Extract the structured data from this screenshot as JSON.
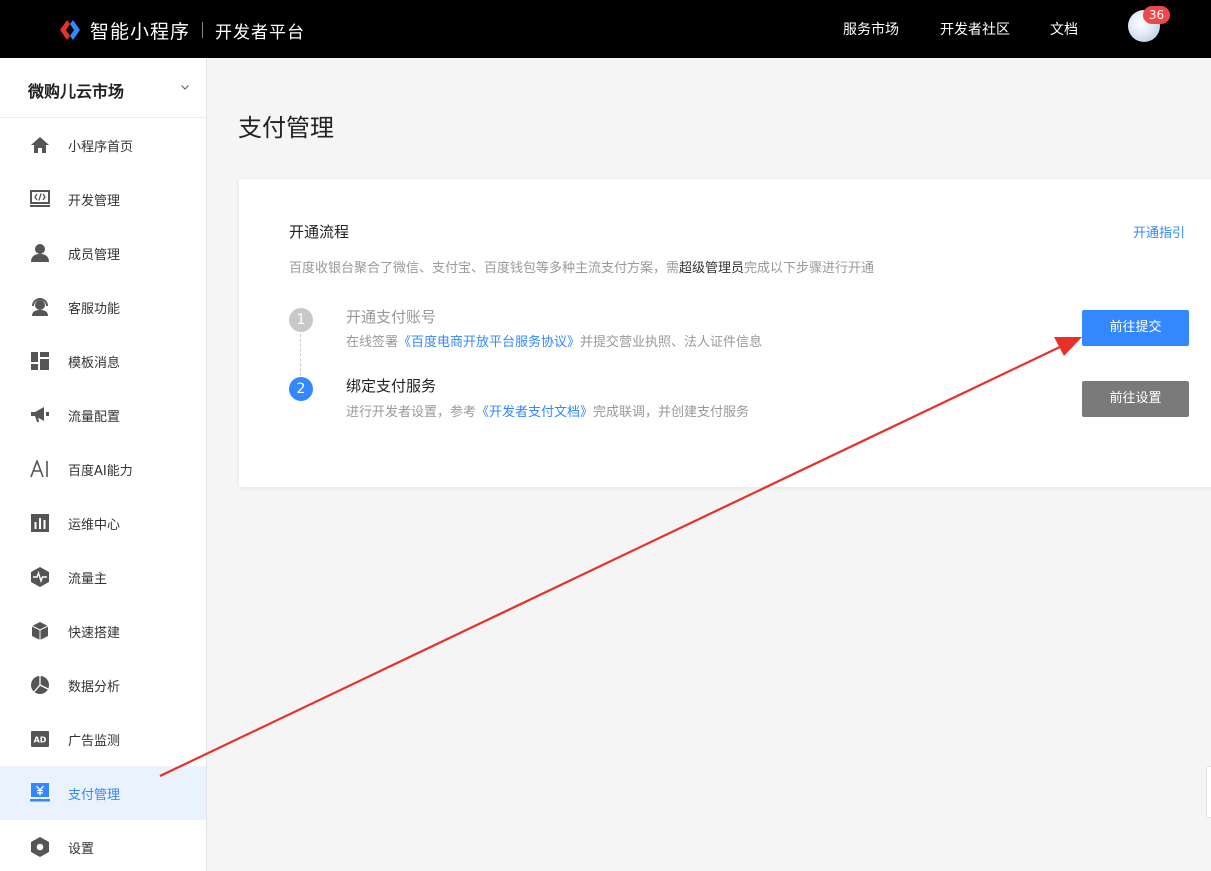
{
  "header": {
    "brand": "智能小程序",
    "subtitle": "开发者平台",
    "nav": [
      "服务市场",
      "开发者社区",
      "文档"
    ],
    "notification_count": "36"
  },
  "sidebar": {
    "app_name": "微购儿云市场",
    "items": [
      {
        "label": "小程序首页",
        "icon": "home-icon"
      },
      {
        "label": "开发管理",
        "icon": "code-icon"
      },
      {
        "label": "成员管理",
        "icon": "user-icon"
      },
      {
        "label": "客服功能",
        "icon": "headset-icon"
      },
      {
        "label": "模板消息",
        "icon": "template-icon"
      },
      {
        "label": "流量配置",
        "icon": "megaphone-icon"
      },
      {
        "label": "百度AI能力",
        "icon": "ai-icon"
      },
      {
        "label": "运维中心",
        "icon": "chart-bars-icon"
      },
      {
        "label": "流量主",
        "icon": "pulse-icon"
      },
      {
        "label": "快速搭建",
        "icon": "cube-icon"
      },
      {
        "label": "数据分析",
        "icon": "pie-icon"
      },
      {
        "label": "广告监测",
        "icon": "ad-icon"
      },
      {
        "label": "支付管理",
        "icon": "payment-icon",
        "active": true
      },
      {
        "label": "设置",
        "icon": "settings-icon"
      }
    ]
  },
  "main": {
    "title": "支付管理",
    "card": {
      "title": "开通流程",
      "guide_link": "开通指引",
      "desc_prefix": "百度收银台聚合了微信、支付宝、百度钱包等多种主流支付方案，需",
      "desc_bold": "超级管理员",
      "desc_suffix": "完成以下步骤进行开通",
      "steps": [
        {
          "num": "1",
          "title": "开通支付账号",
          "desc_prefix": "在线签署",
          "desc_link": "《百度电商开放平台服务协议》",
          "desc_suffix": "并提交营业执照、法人证件信息",
          "button": "前往提交"
        },
        {
          "num": "2",
          "title": "绑定支付服务",
          "desc_prefix": "进行开发者设置，参考",
          "desc_link": "《开发者支付文档》",
          "desc_suffix": "完成联调，并创建支付服务",
          "button": "前往设置"
        }
      ]
    }
  },
  "colors": {
    "accent": "#3388ff",
    "annotation_arrow": "#e8302a",
    "badge": "#f0484a"
  }
}
